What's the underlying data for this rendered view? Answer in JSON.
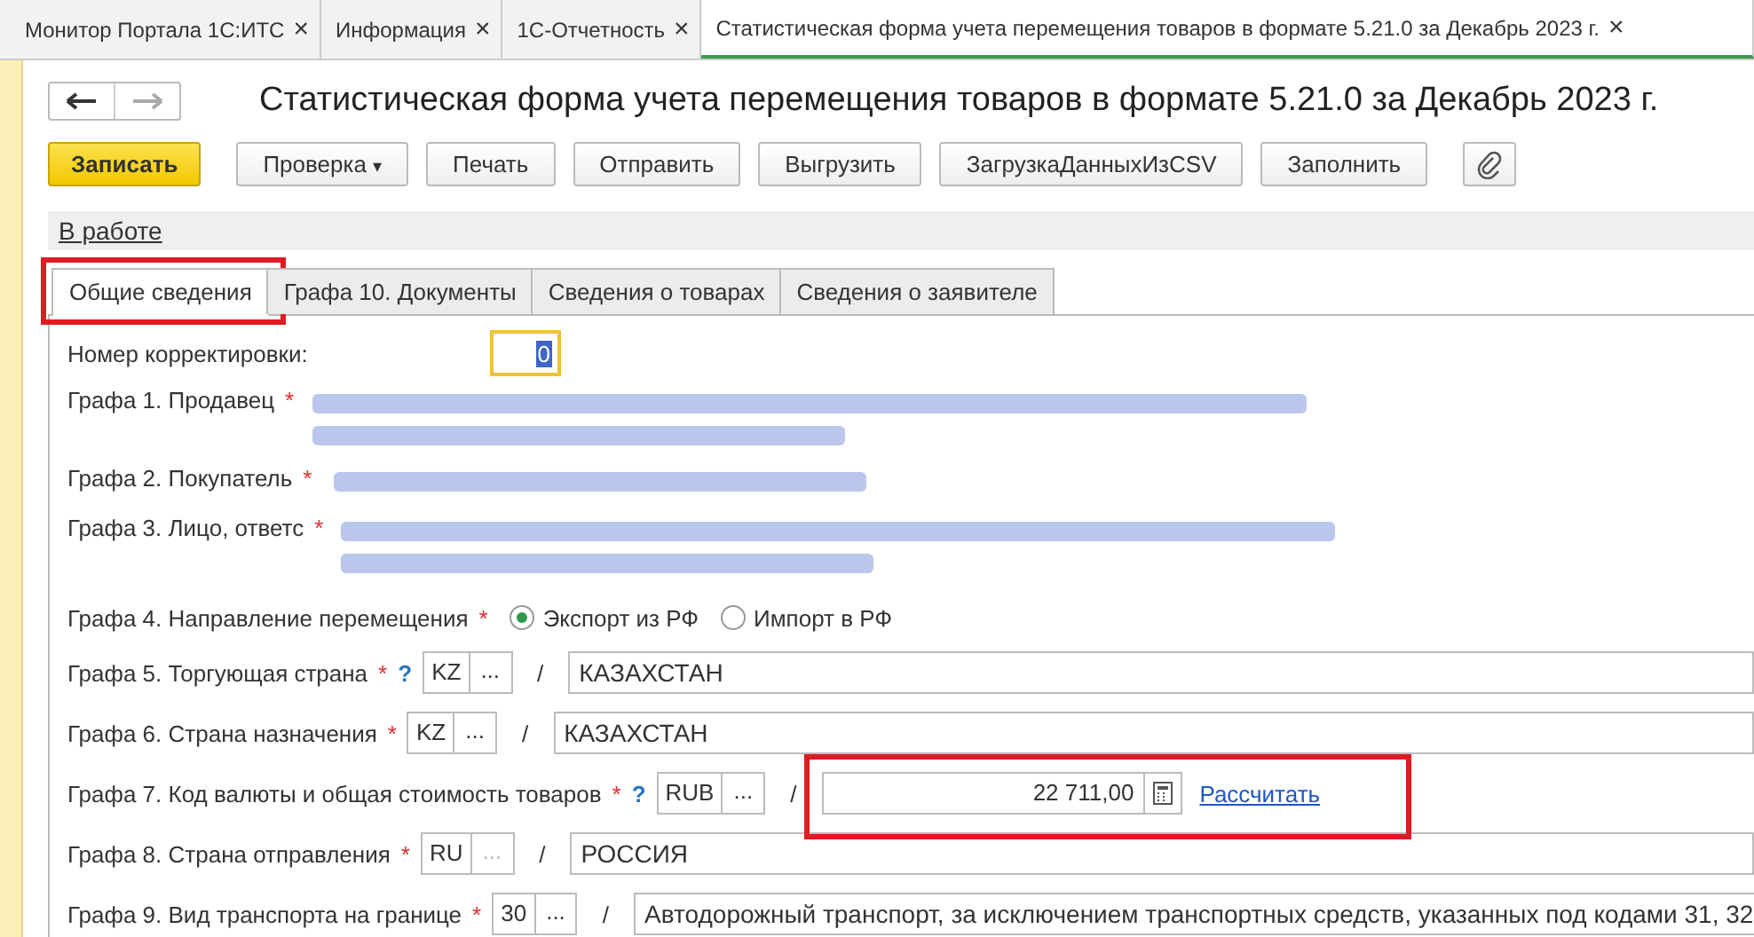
{
  "window_tabs": [
    {
      "label": "Монитор Портала 1С:ИТС",
      "close": "×",
      "selected": false
    },
    {
      "label": "Информация",
      "close": "×",
      "selected": false
    },
    {
      "label": "1С-Отчетность",
      "close": "×",
      "selected": false
    },
    {
      "label": "Статистическая форма учета перемещения товаров в формате 5.21.0 за Декабрь 2023 г.",
      "close": "×",
      "selected": true
    }
  ],
  "title": "Статистическая форма учета перемещения товаров в формате 5.21.0 за Декабрь 2023 г.",
  "toolbar": [
    {
      "label": "Записать",
      "kind": "primary"
    },
    {
      "label": "Проверка",
      "kind": "dropdown",
      "caret": "▾"
    },
    {
      "label": "Печать",
      "kind": "plain"
    },
    {
      "label": "Отправить",
      "kind": "plain"
    },
    {
      "label": "Выгрузить",
      "kind": "plain"
    },
    {
      "label": "ЗагрузкаДанныхИзCSV",
      "kind": "plain"
    },
    {
      "label": "Заполнить",
      "kind": "plain"
    },
    {
      "kind": "attach"
    }
  ],
  "status_link": "В работе",
  "form_tabs": [
    {
      "label": "Общие сведения",
      "selected": true,
      "highlighted": true
    },
    {
      "label": "Графа 10. Документы",
      "selected": false,
      "highlighted": false
    },
    {
      "label": "Сведения о товарах",
      "selected": false,
      "highlighted": false
    },
    {
      "label": "Сведения о заявителе",
      "selected": false,
      "highlighted": false
    }
  ],
  "rows": [
    {
      "kind": "number",
      "label": "Номер корректировки:",
      "value": "0"
    },
    {
      "kind": "blurred_long",
      "label": "Графа 1. Продавец",
      "required": "*"
    },
    {
      "kind": "blurred_short",
      "label": "Графа 2. Покупатель",
      "required": "*"
    },
    {
      "kind": "blurred_long",
      "label": "Графа 3. Лицо, ответс",
      "required": "*"
    },
    {
      "kind": "radio",
      "label": "Графа 4. Направление перемещения",
      "required": "*",
      "options": [
        {
          "label": "Экспорт из РФ",
          "selected": true
        },
        {
          "label": "Импорт в РФ",
          "selected": false
        }
      ]
    },
    {
      "kind": "code",
      "label": "Графа 5. Торгующая страна",
      "required": "*",
      "help": "?",
      "code": "KZ",
      "more": "...",
      "sep": "/",
      "name": "КАЗАХСТАН"
    },
    {
      "kind": "code",
      "label": "Графа 6. Страна назначения",
      "required": "*",
      "code": "KZ",
      "more": "...",
      "sep": "/",
      "name": "КАЗАХСТАН"
    },
    {
      "kind": "amount",
      "label": "Графа 7. Код валюты и общая стоимость товаров",
      "required": "*",
      "help": "?",
      "code": "RUB",
      "more": "...",
      "sep": "/",
      "amount": "22 711,00",
      "link": "Рассчитать",
      "highlighted": true
    },
    {
      "kind": "code",
      "label": "Графа 8. Страна отправления",
      "required": "*",
      "code": "RU",
      "more": "...",
      "sep": "/",
      "name": "РОССИЯ",
      "disabled": true
    },
    {
      "kind": "code",
      "label": "Графа 9. Вид транспорта на границе",
      "required": "*",
      "code": "30",
      "more": "...",
      "sep": "/",
      "name": "Автодорожный транспорт, за исключением транспортных средств, указанных под кодами 31, 32"
    }
  ]
}
